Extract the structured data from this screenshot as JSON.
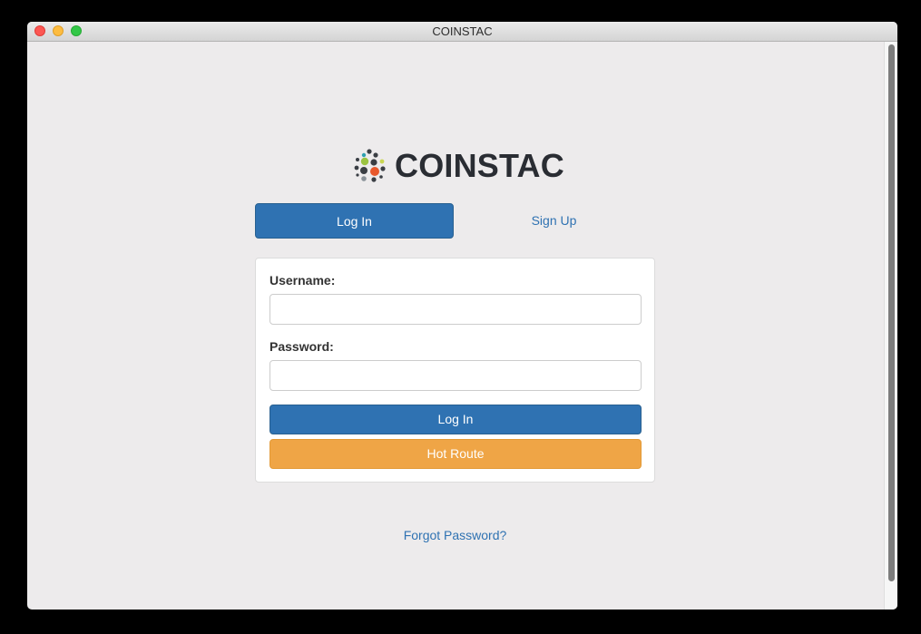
{
  "window": {
    "title": "COINSTAC"
  },
  "brand": {
    "name": "COINSTAC",
    "logo_icon": "coinstac-dots-logo"
  },
  "tabs": {
    "login_label": "Log In",
    "signup_label": "Sign Up",
    "active": "login"
  },
  "form": {
    "username_label": "Username:",
    "username_value": "",
    "password_label": "Password:",
    "password_value": "",
    "login_button": "Log In",
    "hot_route_button": "Hot Route"
  },
  "links": {
    "forgot_password": "Forgot Password?"
  },
  "colors": {
    "primary": "#2f72b2",
    "warning": "#efa546",
    "background": "#edebec",
    "logo_text": "#2a2d33"
  }
}
